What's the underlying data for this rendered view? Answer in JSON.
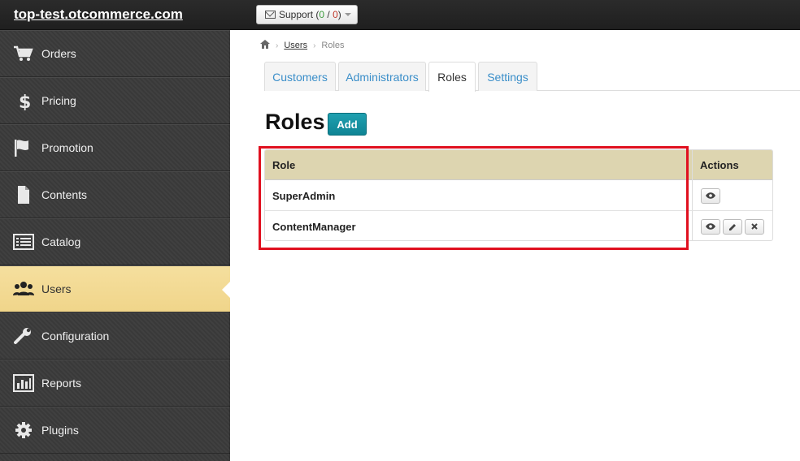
{
  "header": {
    "site_title": "top-test.otcommerce.com",
    "support": {
      "label": "Support",
      "open": "0",
      "slash": "/",
      "closed": "0",
      "lparen": "(",
      "rparen": ")"
    }
  },
  "sidebar": {
    "items": [
      {
        "label": "Orders",
        "icon": "cart-icon"
      },
      {
        "label": "Pricing",
        "icon": "dollar-icon"
      },
      {
        "label": "Promotion",
        "icon": "flag-icon"
      },
      {
        "label": "Contents",
        "icon": "file-icon"
      },
      {
        "label": "Catalog",
        "icon": "list-icon"
      },
      {
        "label": "Users",
        "icon": "users-icon",
        "active": true
      },
      {
        "label": "Configuration",
        "icon": "wrench-icon"
      },
      {
        "label": "Reports",
        "icon": "bar-chart-icon"
      },
      {
        "label": "Plugins",
        "icon": "gear-icon"
      }
    ]
  },
  "breadcrumb": {
    "home_icon": "home-icon",
    "users": "Users",
    "current": "Roles",
    "sep": "›"
  },
  "tabs": [
    {
      "label": "Customers"
    },
    {
      "label": "Administrators"
    },
    {
      "label": "Roles",
      "active": true
    },
    {
      "label": "Settings"
    }
  ],
  "page": {
    "title": "Roles",
    "add_label": "Add"
  },
  "table": {
    "headers": {
      "role": "Role",
      "actions": "Actions"
    },
    "rows": [
      {
        "role": "SuperAdmin",
        "actions": [
          "view"
        ]
      },
      {
        "role": "ContentManager",
        "actions": [
          "view",
          "edit",
          "delete"
        ]
      }
    ]
  },
  "colors": {
    "accent": "#0f8494",
    "active_nav": "#f0d58a",
    "table_header": "#ddd5b0",
    "highlight": "#e0101f",
    "link": "#3a8ec9"
  }
}
